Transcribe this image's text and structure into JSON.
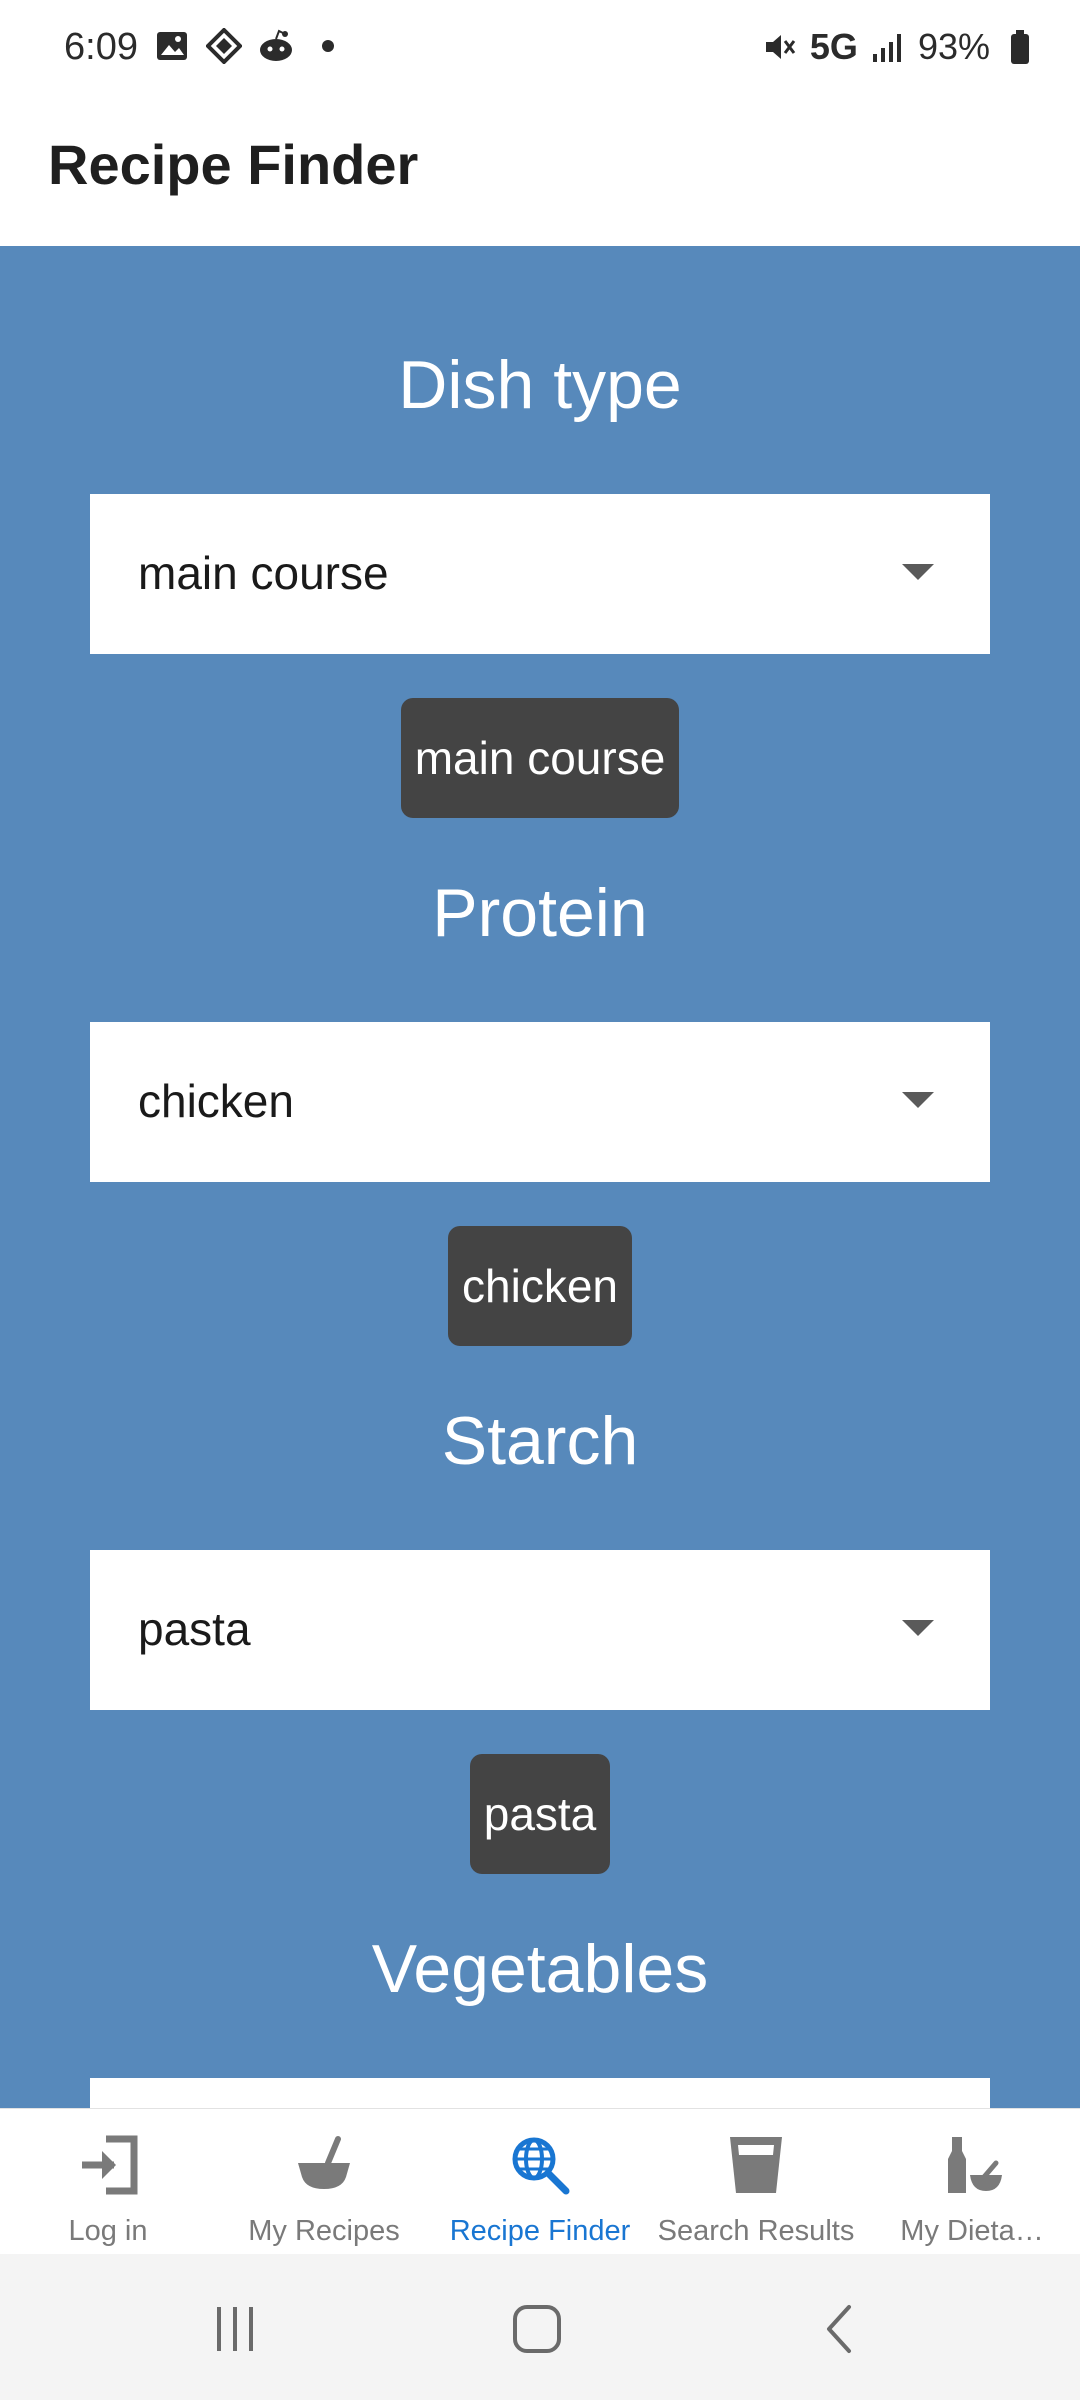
{
  "status_bar": {
    "time": "6:09",
    "network": "5G",
    "battery": "93%",
    "icons": [
      "image-icon",
      "diamond-icon",
      "reddit-icon",
      "dot-icon",
      "mute-icon",
      "signal-icon",
      "battery-icon"
    ]
  },
  "app_bar": {
    "title": "Recipe Finder"
  },
  "filters": [
    {
      "title": "Dish type",
      "selected": "main course",
      "chip": "main course"
    },
    {
      "title": "Protein",
      "selected": "chicken",
      "chip": "chicken"
    },
    {
      "title": "Starch",
      "selected": "pasta",
      "chip": "pasta"
    },
    {
      "title": "Vegetables"
    }
  ],
  "bottom_nav": {
    "items": [
      {
        "label": "Log in",
        "icon": "login-icon",
        "active": false
      },
      {
        "label": "My Recipes",
        "icon": "mortar-pestle-icon",
        "active": false
      },
      {
        "label": "Recipe Finder",
        "icon": "globe-search-icon",
        "active": true
      },
      {
        "label": "Search Results",
        "icon": "cup-icon",
        "active": false
      },
      {
        "label": "My Dieta…",
        "icon": "bottle-bowl-icon",
        "active": false
      }
    ]
  },
  "colors": {
    "content_bg": "#5789bb",
    "chip_bg": "#444444",
    "active_nav": "#1976d2",
    "inactive_nav": "#7a7a7a"
  }
}
